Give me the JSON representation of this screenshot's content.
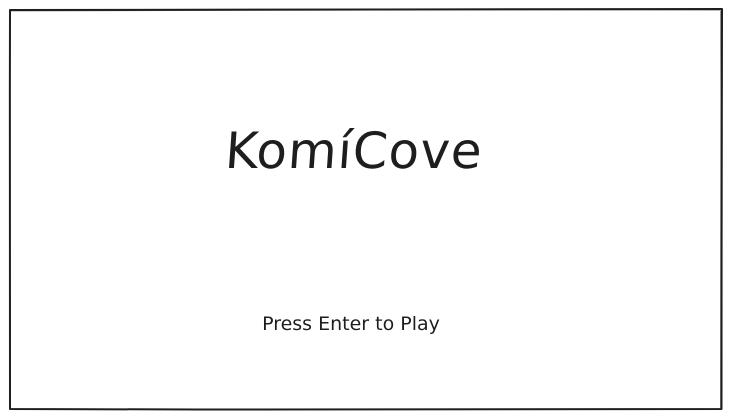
{
  "game": {
    "title": "KomíCove",
    "prompt": "Press Enter to Play"
  },
  "colors": {
    "background": "#ffffff",
    "ink": "#1e1e1e"
  }
}
